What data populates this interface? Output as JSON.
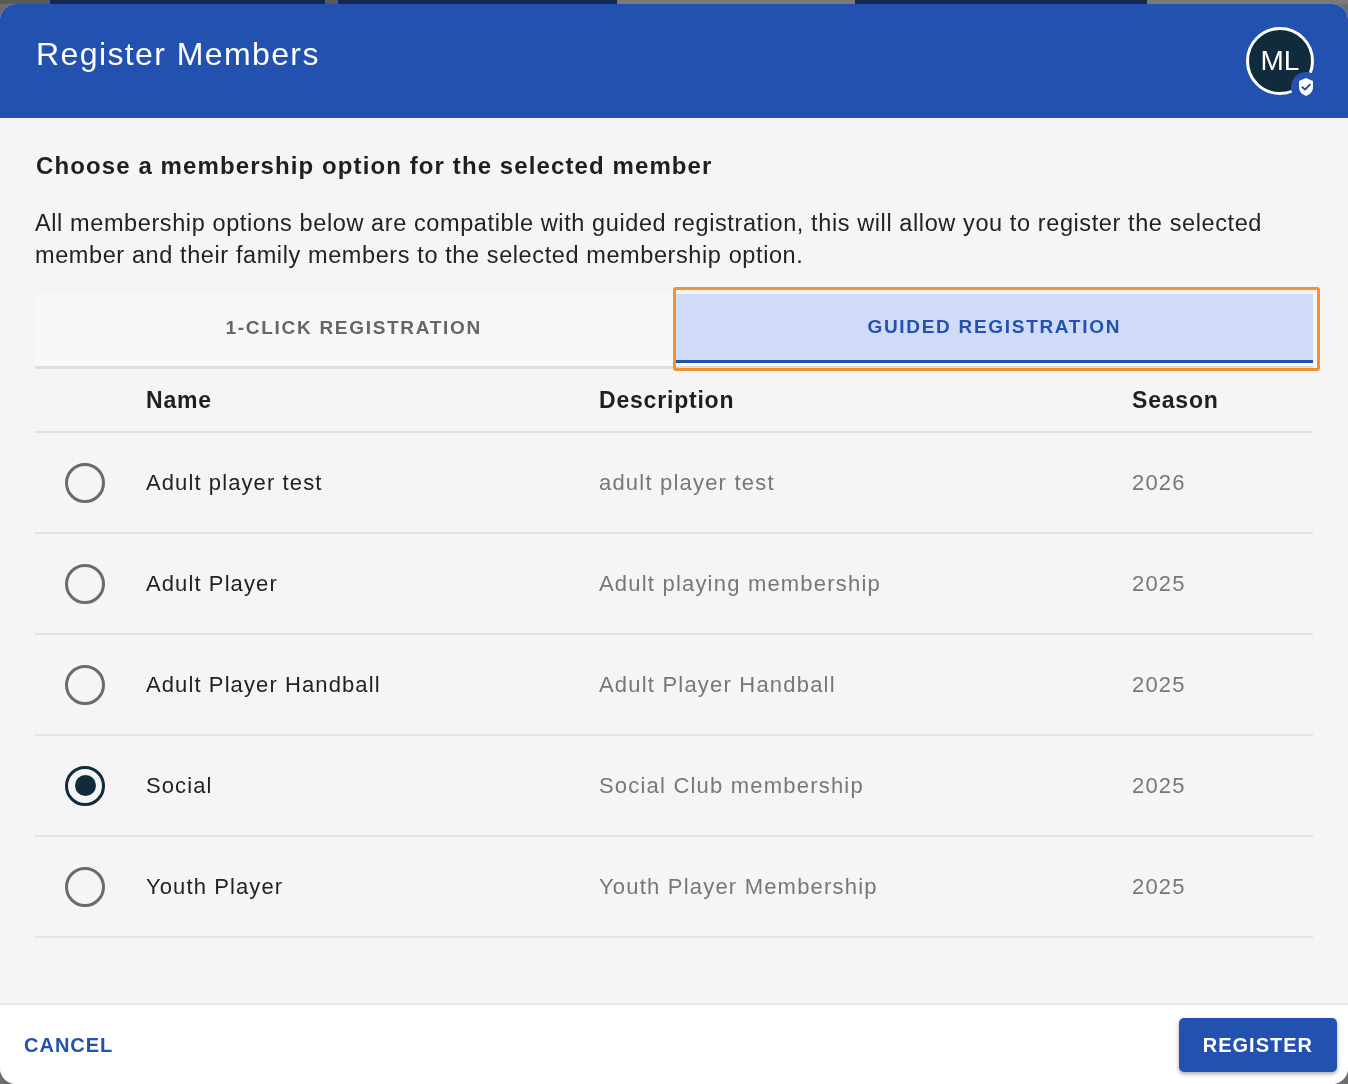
{
  "dialog": {
    "title": "Register Members"
  },
  "avatar": {
    "initials": "ML",
    "verified": true
  },
  "heading": "Choose a membership option for the selected member",
  "description": "All membership options below are compatible with guided registration, this will allow you to register the selected member and their family members to the selected membership option.",
  "tabs": [
    {
      "label": "1-CLICK REGISTRATION",
      "selected": false,
      "focused": false
    },
    {
      "label": "GUIDED REGISTRATION",
      "selected": true,
      "focused": true
    }
  ],
  "table": {
    "columns": [
      "Name",
      "Description",
      "Season"
    ],
    "rows": [
      {
        "name": "Adult player test",
        "description": "adult player test",
        "season": "2026",
        "selected": false
      },
      {
        "name": "Adult Player",
        "description": "Adult playing membership",
        "season": "2025",
        "selected": false
      },
      {
        "name": "Adult Player Handball",
        "description": "Adult Player Handball",
        "season": "2025",
        "selected": false
      },
      {
        "name": "Social",
        "description": "Social Club membership",
        "season": "2025",
        "selected": true
      },
      {
        "name": "Youth Player",
        "description": "Youth Player Membership",
        "season": "2025",
        "selected": false
      }
    ]
  },
  "footer": {
    "buttons": [
      {
        "label": "CANCEL",
        "kind": "text"
      },
      {
        "label": "REGISTER",
        "kind": "contained"
      }
    ]
  }
}
